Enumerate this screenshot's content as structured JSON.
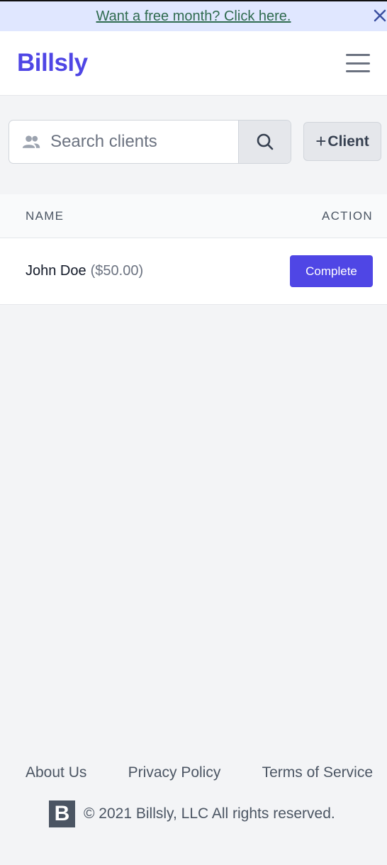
{
  "promo": {
    "text": "Want a free month? Click here."
  },
  "header": {
    "brand": "Billsly"
  },
  "search": {
    "placeholder": "Search clients",
    "value": ""
  },
  "toolbar": {
    "add_plus": "+",
    "add_label": "Client"
  },
  "table": {
    "columns": [
      "NAME",
      "ACTION"
    ],
    "rows": [
      {
        "name": "John Doe",
        "amount": "($50.00)",
        "action": "Complete"
      }
    ]
  },
  "footer": {
    "links": [
      "About Us",
      "Privacy Policy",
      "Terms of Service"
    ],
    "logo_letter": "B",
    "copyright": "© 2021 Billsly, LLC All rights reserved."
  },
  "colors": {
    "brand": "#4f46e5",
    "promo_bg": "#e0e7ff",
    "promo_link": "#2f6b4f",
    "page_bg": "#f3f4f6"
  },
  "icons": [
    "close-icon",
    "hamburger-menu-icon",
    "users-icon",
    "search-icon",
    "brand-logo-icon"
  ]
}
